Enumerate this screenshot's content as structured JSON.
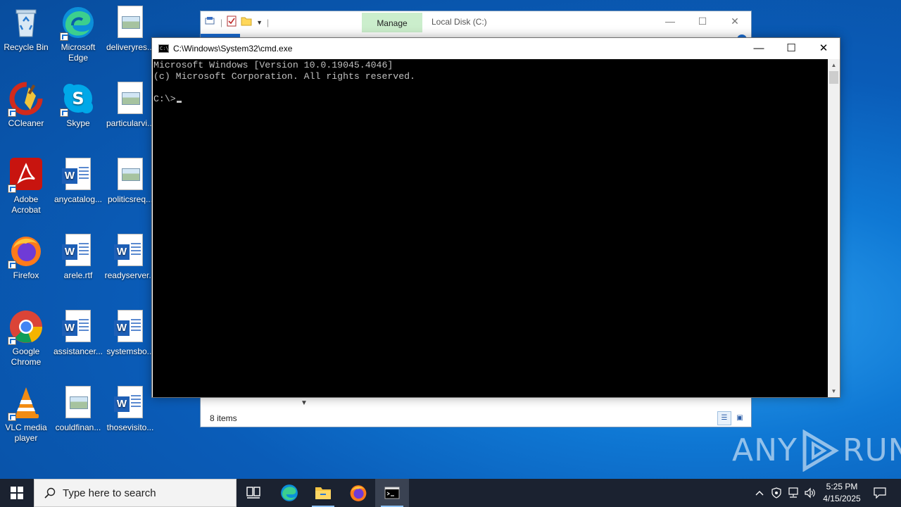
{
  "desktop": {
    "icons": [
      {
        "label": "Recycle Bin",
        "icon": "recycle-bin-icon"
      },
      {
        "label": "Microsoft Edge",
        "icon": "edge-icon"
      },
      {
        "label": "deliveryres...",
        "icon": "image-file-icon"
      },
      {
        "label": "CCleaner",
        "icon": "ccleaner-icon"
      },
      {
        "label": "Skype",
        "icon": "skype-icon"
      },
      {
        "label": "particularvi...",
        "icon": "image-file-icon"
      },
      {
        "label": "Adobe Acrobat",
        "icon": "acrobat-icon"
      },
      {
        "label": "anycatalog...",
        "icon": "word-doc-icon"
      },
      {
        "label": "politicsreq...",
        "icon": "image-file-icon"
      },
      {
        "label": "Firefox",
        "icon": "firefox-icon"
      },
      {
        "label": "arele.rtf",
        "icon": "word-doc-icon"
      },
      {
        "label": "readyserver...",
        "icon": "word-doc-icon"
      },
      {
        "label": "Google Chrome",
        "icon": "chrome-icon"
      },
      {
        "label": "assistancer...",
        "icon": "word-doc-icon"
      },
      {
        "label": "systemsbo...",
        "icon": "word-doc-icon"
      },
      {
        "label": "VLC media player",
        "icon": "vlc-icon"
      },
      {
        "label": "couldfinan...",
        "icon": "image-file-icon"
      },
      {
        "label": "thosevisito...",
        "icon": "word-doc-icon"
      }
    ]
  },
  "explorer": {
    "manage_tab": "Manage",
    "title": "Local Disk (C:)",
    "status_items": "8 items",
    "controls": {
      "minimize": "—",
      "maximize": "☐",
      "close": "✕"
    }
  },
  "cmd": {
    "title": "C:\\Windows\\System32\\cmd.exe",
    "lines": [
      "Microsoft Windows [Version 10.0.19045.4046]",
      "(c) Microsoft Corporation. All rights reserved.",
      "",
      "C:\\>"
    ],
    "controls": {
      "minimize": "—",
      "maximize": "☐",
      "close": "✕"
    }
  },
  "watermark": {
    "left": "ANY",
    "right": "RUN"
  },
  "taskbar": {
    "search_placeholder": "Type here to search",
    "pinned": [
      "task-view-icon",
      "edge-icon",
      "file-explorer-icon",
      "firefox-icon",
      "cmd-icon"
    ],
    "clock_time": "5:25 PM",
    "clock_date": "4/15/2025"
  },
  "colors": {
    "desktop_blue": "#0f78d4",
    "taskbar": "#1b2230",
    "console_bg": "#000000",
    "console_fg": "#c0c0c0",
    "manage_tab_bg": "#cbeecc"
  }
}
